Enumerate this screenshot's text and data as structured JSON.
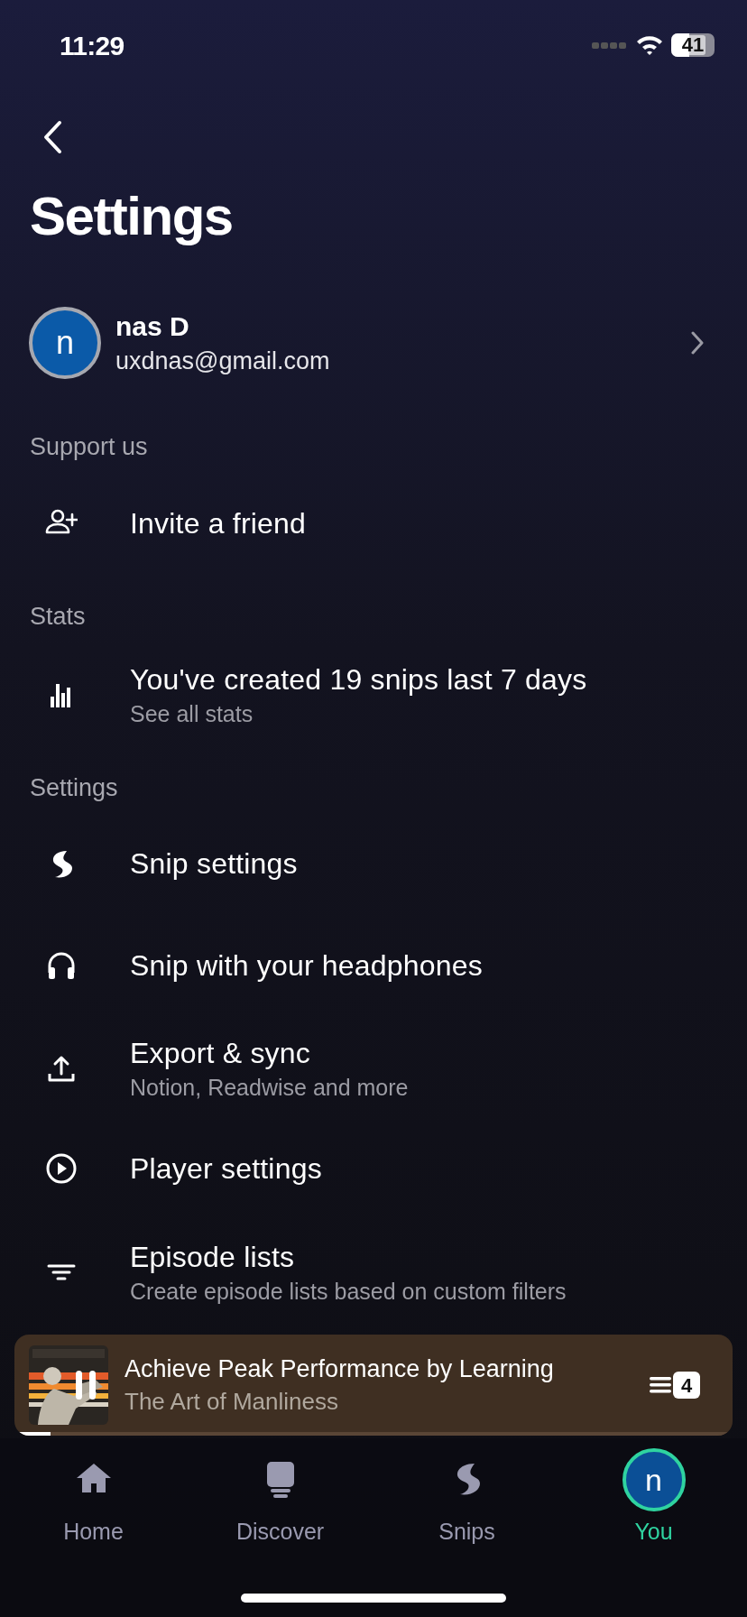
{
  "status_bar": {
    "time": "11:29",
    "battery": "41"
  },
  "title": "Settings",
  "profile": {
    "initial": "n",
    "name": "nas D",
    "email": "uxdnas@gmail.com"
  },
  "sections": [
    {
      "header": "Support us",
      "items": [
        {
          "label": "Invite a friend"
        }
      ]
    },
    {
      "header": "Stats",
      "items": [
        {
          "label": "You've created 19 snips last 7 days",
          "subtitle": "See all stats"
        }
      ]
    },
    {
      "header": "Settings",
      "items": [
        {
          "label": "Snip settings"
        },
        {
          "label": "Snip with your headphones"
        },
        {
          "label": "Export & sync",
          "subtitle": "Notion, Readwise and more"
        },
        {
          "label": "Player settings"
        },
        {
          "label": "Episode lists",
          "subtitle": "Create episode lists based on custom filters"
        }
      ]
    }
  ],
  "now_playing": {
    "title": "Achieve Peak Performance by Learning",
    "podcast": "The Art of Manliness",
    "queue_count": "4",
    "level": 0.05
  },
  "tabs": [
    {
      "kind": "icon",
      "label": "Home",
      "selected": false
    },
    {
      "kind": "icon",
      "label": "Discover",
      "selected": false
    },
    {
      "kind": "icon",
      "label": "Snips",
      "selected": false
    },
    {
      "kind": "avatar",
      "label": "You",
      "initial": "n",
      "selected": true
    }
  ]
}
